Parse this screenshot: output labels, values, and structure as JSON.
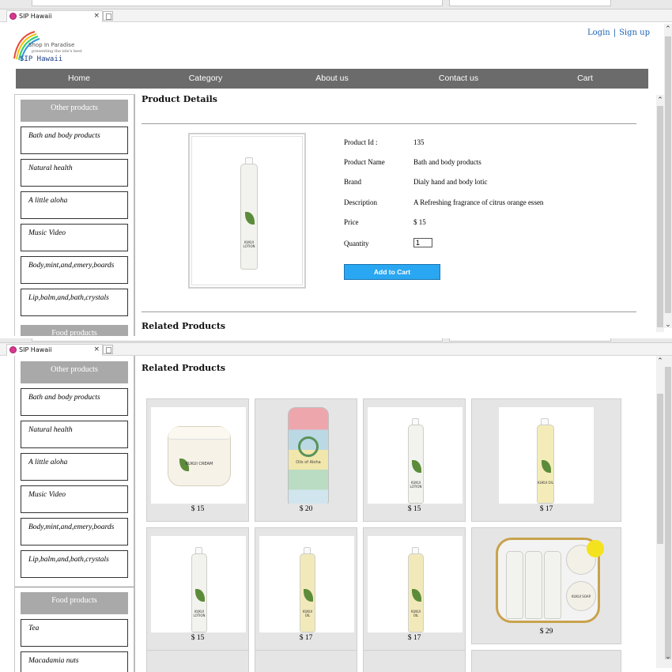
{
  "tab": {
    "title": "SIP Hawaii",
    "close": "×"
  },
  "logo": {
    "line1": "Shop In Paradise",
    "line2": "presenting  the isle's best",
    "line3": "SIP Hawaii"
  },
  "auth": {
    "login": "Login",
    "separator": "|",
    "signup": "Sign up"
  },
  "nav": [
    "Home",
    "Category",
    "About us",
    "Contact us",
    "Cart"
  ],
  "sidebar": {
    "other_header": "Other products",
    "other_items": [
      "Bath and body products",
      "Natural health",
      "A little aloha",
      "Music Video",
      "Body,mint,and,emery,boards",
      "Lip,balm,and,bath,crystals"
    ],
    "food_header": "Food products",
    "food_items": [
      "Tea",
      "Macadamia nuts"
    ]
  },
  "product": {
    "section_title": "Product Details",
    "fields": [
      {
        "label": "Product Id :",
        "value": "135"
      },
      {
        "label": "Product Name",
        "value": "Bath and body products"
      },
      {
        "label": "Brand",
        "value": "Dialy hand and body lotic"
      },
      {
        "label": "Description",
        "value": "A Refreshing fragrance of citrus orange essen"
      },
      {
        "label": "Price",
        "value": "$ 15"
      }
    ],
    "quantity_label": "Quantity",
    "quantity_value": "1",
    "add_to_cart": "Add to Cart",
    "bottle_label": "KUKUI LOTION"
  },
  "related": {
    "title": "Related Products",
    "items": [
      {
        "price": "$ 15",
        "label": "KUKUI CREAM"
      },
      {
        "price": "$ 20",
        "label": "Oils of Aloha"
      },
      {
        "price": "$ 15",
        "label": "KUKUI LOTION"
      },
      {
        "price": "$ 17",
        "label": "KUKUI OIL"
      },
      {
        "price": "$ 15",
        "label": "KUKUI LOTION"
      },
      {
        "price": "$ 17",
        "label": "KUKUI OIL"
      },
      {
        "price": "$ 17",
        "label": "KUKUI OIL"
      },
      {
        "price": "$ 29",
        "label": "KUKUI SOAP"
      }
    ]
  },
  "colors": {
    "nav_bg": "#6b6b6b",
    "link": "#1b62b5",
    "button": "#2aa7f2",
    "sidebar_header": "#a9a9a9"
  }
}
